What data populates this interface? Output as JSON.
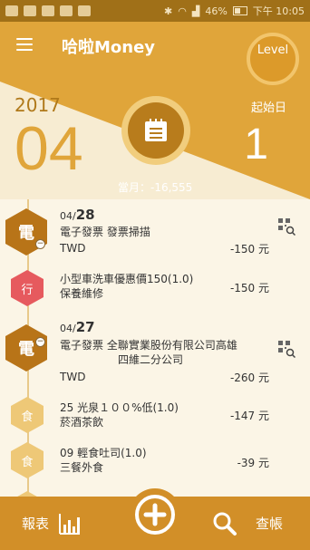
{
  "status_bar": {
    "battery": "46%",
    "time": "下午 10:05"
  },
  "header": {
    "app_title": "哈啦Money",
    "level_label": "Level",
    "year": "2017",
    "month": "04",
    "start_label": "起始日",
    "start_day": "1",
    "month_total": "當月：-16,555"
  },
  "entries": [
    {
      "badge": "電",
      "date_day": "28",
      "date_month": "04/",
      "line1": "電子發票  發票掃描",
      "currency": "TWD",
      "amount": "-150 元",
      "icon": "qr-search-icon"
    },
    {
      "badge": "行",
      "line1": "小型車洗車優惠價150(1.0)",
      "line2": "保養維修",
      "amount": "-150 元"
    },
    {
      "badge": "電",
      "date_day": "27",
      "date_month": "04/",
      "line1": "電子發票  全聯實業股份有限公司高雄",
      "line2": "四維二分公司",
      "currency": "TWD",
      "amount": "-260 元",
      "icon": "qr-search-icon"
    },
    {
      "badge": "食",
      "line1": "25    光泉１００%低(1.0)",
      "line2": "菸酒茶飲",
      "amount": "-147 元"
    },
    {
      "badge": "食",
      "line1": "09    輕食吐司(1.0)",
      "line2": "三餐外食",
      "amount": "-39 元"
    }
  ],
  "bottom_bar": {
    "report_label": "報表",
    "search_label": "查帳"
  },
  "colors": {
    "primary": "#e0a53a",
    "dark": "#b87418",
    "red_badge": "#e65a5e",
    "light_badge": "#eec877"
  }
}
